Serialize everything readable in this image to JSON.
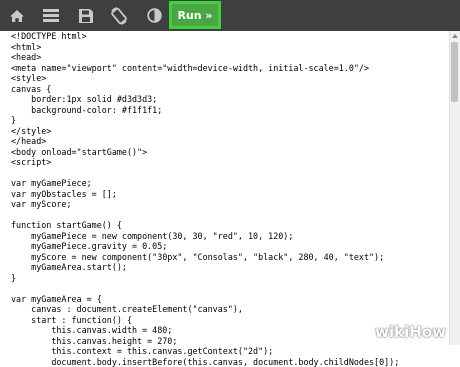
{
  "toolbar": {
    "icons": [
      "home-icon",
      "menu-icon",
      "save-icon",
      "rotate-icon",
      "contrast-icon"
    ],
    "run_label": "Run »",
    "run_color": "#4aa645",
    "highlight_color": "#3fd13b"
  },
  "code_lines": [
    "<!DOCTYPE html>",
    "<html>",
    "<head>",
    "<meta name=\"viewport\" content=\"width=device-width, initial-scale=1.0\"/>",
    "<style>",
    "canvas {",
    "    border:1px solid #d3d3d3;",
    "    background-color: #f1f1f1;",
    "}",
    "</style>",
    "</head>",
    "<body onload=\"startGame()\">",
    "<script>",
    "",
    "var myGamePiece;",
    "var myObstacles = [];",
    "var myScore;",
    "",
    "function startGame() {",
    "    myGamePiece = new component(30, 30, \"red\", 10, 120);",
    "    myGamePiece.gravity = 0.05;",
    "    myScore = new component(\"30px\", \"Consolas\", \"black\", 280, 40, \"text\");",
    "    myGameArea.start();",
    "}",
    "",
    "var myGameArea = {",
    "    canvas : document.createElement(\"canvas\"),",
    "    start : function() {",
    "        this.canvas.width = 480;",
    "        this.canvas.height = 270;",
    "        this.context = this.canvas.getContext(\"2d\");",
    "        document.body.insertBefore(this.canvas, document.body.childNodes[0]);"
  ],
  "watermark": {
    "prefix": "wiki",
    "suffix": "How"
  }
}
